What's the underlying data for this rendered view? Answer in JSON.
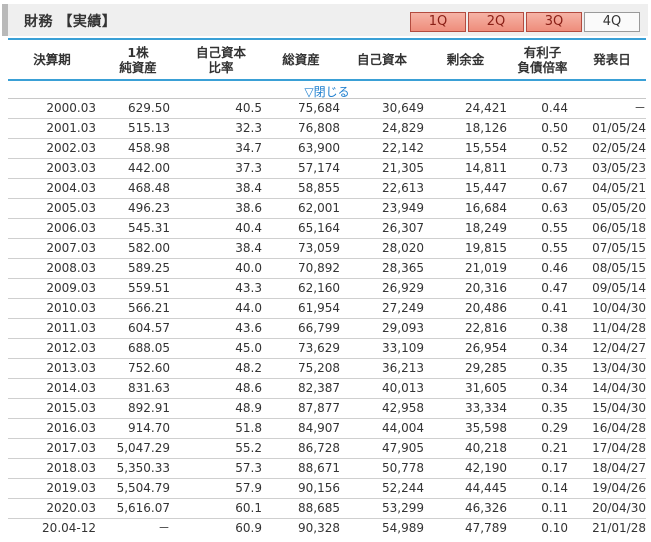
{
  "section": {
    "title": "財務 【実績】"
  },
  "tabs": [
    "1Q",
    "2Q",
    "3Q",
    "4Q"
  ],
  "active_tab": "4Q",
  "table": {
    "headers": [
      "決算期",
      "1株\n純資産",
      "自己資本\n比率",
      "総資産",
      "自己資本",
      "剰余金",
      "有利子\n負債倍率",
      "発表日"
    ],
    "toggle_label": "▽閉じる",
    "rows": [
      [
        "2000.03",
        "629.50",
        "40.5",
        "75,684",
        "30,649",
        "24,421",
        "0.44",
        "－"
      ],
      [
        "2001.03",
        "515.13",
        "32.3",
        "76,808",
        "24,829",
        "18,126",
        "0.50",
        "01/05/24"
      ],
      [
        "2002.03",
        "458.98",
        "34.7",
        "63,900",
        "22,142",
        "15,554",
        "0.52",
        "02/05/24"
      ],
      [
        "2003.03",
        "442.00",
        "37.3",
        "57,174",
        "21,305",
        "14,811",
        "0.73",
        "03/05/23"
      ],
      [
        "2004.03",
        "468.48",
        "38.4",
        "58,855",
        "22,613",
        "15,447",
        "0.67",
        "04/05/21"
      ],
      [
        "2005.03",
        "496.23",
        "38.6",
        "62,001",
        "23,949",
        "16,684",
        "0.63",
        "05/05/20"
      ],
      [
        "2006.03",
        "545.31",
        "40.4",
        "65,164",
        "26,307",
        "18,249",
        "0.55",
        "06/05/18"
      ],
      [
        "2007.03",
        "582.00",
        "38.4",
        "73,059",
        "28,020",
        "19,815",
        "0.55",
        "07/05/15"
      ],
      [
        "2008.03",
        "589.25",
        "40.0",
        "70,892",
        "28,365",
        "21,019",
        "0.46",
        "08/05/15"
      ],
      [
        "2009.03",
        "559.51",
        "43.3",
        "62,160",
        "26,929",
        "20,316",
        "0.47",
        "09/05/14"
      ],
      [
        "2010.03",
        "566.21",
        "44.0",
        "61,954",
        "27,249",
        "20,486",
        "0.41",
        "10/04/30"
      ],
      [
        "2011.03",
        "604.57",
        "43.6",
        "66,799",
        "29,093",
        "22,816",
        "0.38",
        "11/04/28"
      ],
      [
        "2012.03",
        "688.05",
        "45.0",
        "73,629",
        "33,109",
        "26,954",
        "0.34",
        "12/04/27"
      ],
      [
        "2013.03",
        "752.60",
        "48.2",
        "75,208",
        "36,213",
        "29,285",
        "0.35",
        "13/04/30"
      ],
      [
        "2014.03",
        "831.63",
        "48.6",
        "82,387",
        "40,013",
        "31,605",
        "0.34",
        "14/04/30"
      ],
      [
        "2015.03",
        "892.91",
        "48.9",
        "87,877",
        "42,958",
        "33,334",
        "0.35",
        "15/04/30"
      ],
      [
        "2016.03",
        "914.70",
        "51.8",
        "84,907",
        "44,004",
        "35,598",
        "0.29",
        "16/04/28"
      ],
      [
        "2017.03",
        "5,047.29",
        "55.2",
        "86,728",
        "47,905",
        "40,218",
        "0.21",
        "17/04/28"
      ],
      [
        "2018.03",
        "5,350.33",
        "57.3",
        "88,671",
        "50,778",
        "42,190",
        "0.17",
        "18/04/27"
      ],
      [
        "2019.03",
        "5,504.79",
        "57.9",
        "90,156",
        "52,244",
        "44,445",
        "0.14",
        "19/04/26"
      ],
      [
        "2020.03",
        "5,616.07",
        "60.1",
        "88,685",
        "53,299",
        "46,326",
        "0.11",
        "20/04/30"
      ],
      [
        "20.04-12",
        "－",
        "60.9",
        "90,328",
        "54,989",
        "47,789",
        "0.10",
        "21/01/28"
      ]
    ]
  }
}
